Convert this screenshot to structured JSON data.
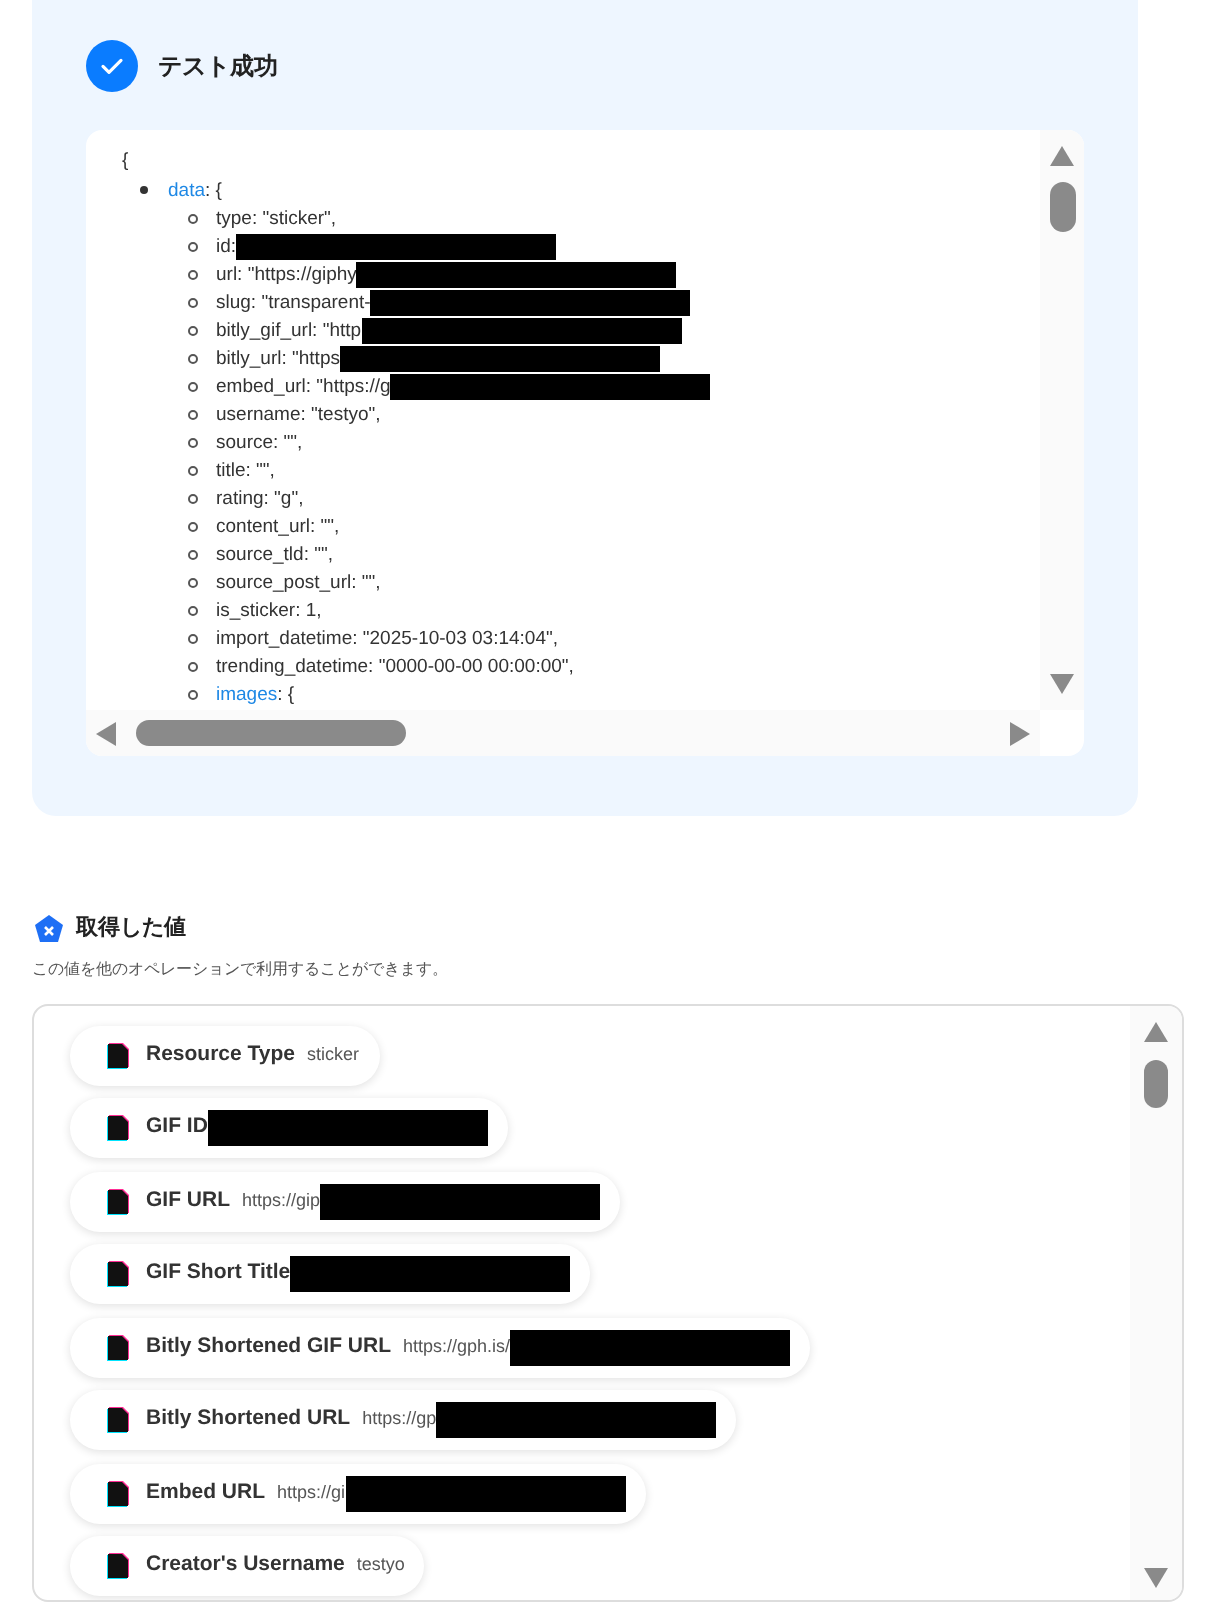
{
  "test_result": {
    "title": "テスト成功",
    "code": {
      "open_brace": "{",
      "lines": [
        {
          "kind": "object",
          "key": "data",
          "text": ": {",
          "children": [
            {
              "kind": "value",
              "text": "type: \"sticker\",",
              "redacted": false
            },
            {
              "kind": "value",
              "text": "id:",
              "redacted": true
            },
            {
              "kind": "value",
              "text": "url: \"https://giphy",
              "redacted": true
            },
            {
              "kind": "value",
              "text": "slug: \"transparent-",
              "redacted": true
            },
            {
              "kind": "value",
              "text": "bitly_gif_url: \"http",
              "redacted": true
            },
            {
              "kind": "value",
              "text": "bitly_url: \"https",
              "redacted": true
            },
            {
              "kind": "value",
              "text": "embed_url: \"https://g",
              "redacted": true
            },
            {
              "kind": "value",
              "text": "username: \"testyo\",",
              "redacted": false
            },
            {
              "kind": "value",
              "text": "source: \"\",",
              "redacted": false
            },
            {
              "kind": "value",
              "text": "title: \"\",",
              "redacted": false
            },
            {
              "kind": "value",
              "text": "rating: \"g\",",
              "redacted": false
            },
            {
              "kind": "value",
              "text": "content_url: \"\",",
              "redacted": false
            },
            {
              "kind": "value",
              "text": "source_tld: \"\",",
              "redacted": false
            },
            {
              "kind": "value",
              "text": "source_post_url: \"\",",
              "redacted": false
            },
            {
              "kind": "value",
              "text": "is_sticker: 1,",
              "redacted": false
            },
            {
              "kind": "value",
              "text": "import_datetime: \"2025-10-03 03:14:04\",",
              "redacted": false
            },
            {
              "kind": "value",
              "text": "trending_datetime: \"0000-00-00 00:00:00\",",
              "redacted": false
            },
            {
              "kind": "object",
              "key": "images",
              "text": ": {"
            }
          ]
        }
      ]
    }
  },
  "outputs": {
    "title": "取得した値",
    "description": "この値を他のオペレーションで利用することができます。",
    "items": [
      {
        "label": "Resource Type",
        "value": "sticker",
        "redacted": false
      },
      {
        "label": "GIF ID",
        "redacted": true
      },
      {
        "label": "GIF URL",
        "value": "https://gip",
        "redacted": true
      },
      {
        "label": "GIF Short Title",
        "redacted": true
      },
      {
        "label": "Bitly Shortened GIF URL",
        "value": "https://gph.is/",
        "redacted": true
      },
      {
        "label": "Bitly Shortened URL",
        "value": "https://gp",
        "redacted": true
      },
      {
        "label": "Embed URL",
        "value": "https://gi",
        "redacted": true
      },
      {
        "label": "Creator's Username",
        "value": "testyo",
        "redacted": false
      }
    ]
  }
}
